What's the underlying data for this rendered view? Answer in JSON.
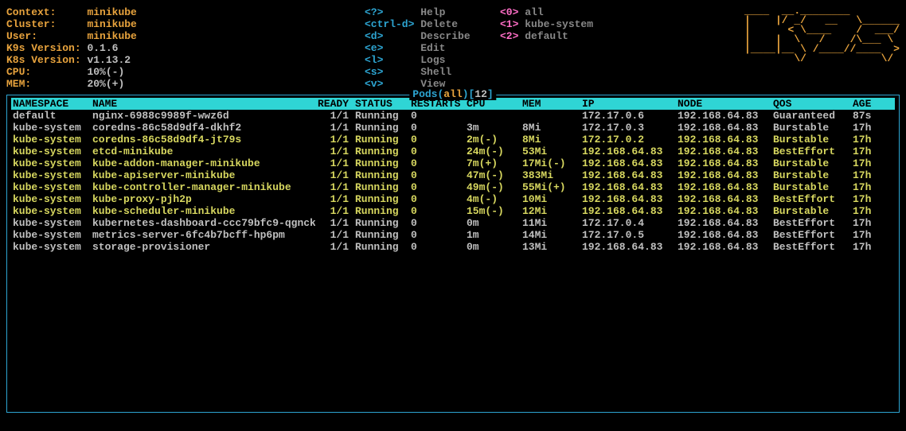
{
  "info": {
    "context_label": "Context:",
    "context": "minikube",
    "cluster_label": "Cluster:",
    "cluster": "minikube",
    "user_label": "User:",
    "user": "minikube",
    "k9s_label": "K9s Version:",
    "k9s": "0.1.6",
    "k8s_label": "K8s Version:",
    "k8s": "v1.13.2",
    "cpu_label": "CPU:",
    "cpu": "10%(-)",
    "mem_label": "MEM:",
    "mem": "20%(+)"
  },
  "hk1": {
    "help_k": "<?>",
    "help_d": "Help",
    "del_k": "<ctrl-d>",
    "del_d": "Delete",
    "desc_k": "<d>",
    "desc_d": "Describe",
    "edit_k": "<e>",
    "edit_d": "Edit",
    "logs_k": "<l>",
    "logs_d": "Logs",
    "shell_k": "<s>",
    "shell_d": "Shell",
    "view_k": "<v>",
    "view_d": "View"
  },
  "hk2": {
    "k0": "<0>",
    "d0": "all",
    "k1": "<1>",
    "d1": "kube-system",
    "k2": "<2>",
    "d2": "default"
  },
  "logo": "____  __.________       \n|    |/ _/   __   \\______\n|      < \\____    /  ___/\n|    |  \\   /    /\\___ \\ \n|____|__ \\ /____//____  >\n        \\/            \\/ ",
  "box": {
    "prefix": " Pods(",
    "all": "all",
    "mid": ")[",
    "count": "12",
    "suffix": "] "
  },
  "th": {
    "ns": "NAMESPACE",
    "name": "NAME",
    "ready": "READY",
    "status": "STATUS",
    "restarts": "RESTARTS",
    "cpu": "CPU",
    "mem": "MEM",
    "ip": "IP",
    "node": "NODE",
    "qos": "QOS",
    "age": "AGE"
  },
  "rows": [
    {
      "hl": false,
      "ns": "default",
      "name": "nginx-6988c9989f-wwz6d",
      "ready": "1/1",
      "status": "Running",
      "restarts": "0",
      "cpu": "",
      "mem": "",
      "ip": "172.17.0.6",
      "node": "192.168.64.83",
      "qos": "Guaranteed",
      "age": "87s"
    },
    {
      "hl": false,
      "ns": "kube-system",
      "name": "coredns-86c58d9df4-dkhf2",
      "ready": "1/1",
      "status": "Running",
      "restarts": "0",
      "cpu": "3m",
      "mem": "8Mi",
      "ip": "172.17.0.3",
      "node": "192.168.64.83",
      "qos": "Burstable",
      "age": "17h"
    },
    {
      "hl": true,
      "ns": "kube-system",
      "name": "coredns-86c58d9df4-jt79s",
      "ready": "1/1",
      "status": "Running",
      "restarts": "0",
      "cpu": "2m(-)",
      "mem": "8Mi",
      "ip": "172.17.0.2",
      "node": "192.168.64.83",
      "qos": "Burstable",
      "age": "17h"
    },
    {
      "hl": true,
      "ns": "kube-system",
      "name": "etcd-minikube",
      "ready": "1/1",
      "status": "Running",
      "restarts": "0",
      "cpu": "24m(-)",
      "mem": "53Mi",
      "ip": "192.168.64.83",
      "node": "192.168.64.83",
      "qos": "BestEffort",
      "age": "17h"
    },
    {
      "hl": true,
      "ns": "kube-system",
      "name": "kube-addon-manager-minikube",
      "ready": "1/1",
      "status": "Running",
      "restarts": "0",
      "cpu": "7m(+)",
      "mem": "17Mi(-)",
      "ip": "192.168.64.83",
      "node": "192.168.64.83",
      "qos": "Burstable",
      "age": "17h"
    },
    {
      "hl": true,
      "ns": "kube-system",
      "name": "kube-apiserver-minikube",
      "ready": "1/1",
      "status": "Running",
      "restarts": "0",
      "cpu": "47m(-)",
      "mem": "383Mi",
      "ip": "192.168.64.83",
      "node": "192.168.64.83",
      "qos": "Burstable",
      "age": "17h"
    },
    {
      "hl": true,
      "ns": "kube-system",
      "name": "kube-controller-manager-minikube",
      "ready": "1/1",
      "status": "Running",
      "restarts": "0",
      "cpu": "49m(-)",
      "mem": "55Mi(+)",
      "ip": "192.168.64.83",
      "node": "192.168.64.83",
      "qos": "Burstable",
      "age": "17h"
    },
    {
      "hl": true,
      "ns": "kube-system",
      "name": "kube-proxy-pjh2p",
      "ready": "1/1",
      "status": "Running",
      "restarts": "0",
      "cpu": "4m(-)",
      "mem": "10Mi",
      "ip": "192.168.64.83",
      "node": "192.168.64.83",
      "qos": "BestEffort",
      "age": "17h"
    },
    {
      "hl": true,
      "ns": "kube-system",
      "name": "kube-scheduler-minikube",
      "ready": "1/1",
      "status": "Running",
      "restarts": "0",
      "cpu": "15m(-)",
      "mem": "12Mi",
      "ip": "192.168.64.83",
      "node": "192.168.64.83",
      "qos": "Burstable",
      "age": "17h"
    },
    {
      "hl": false,
      "ns": "kube-system",
      "name": "kubernetes-dashboard-ccc79bfc9-qgnck",
      "ready": "1/1",
      "status": "Running",
      "restarts": "0",
      "cpu": "0m",
      "mem": "11Mi",
      "ip": "172.17.0.4",
      "node": "192.168.64.83",
      "qos": "BestEffort",
      "age": "17h"
    },
    {
      "hl": false,
      "ns": "kube-system",
      "name": "metrics-server-6fc4b7bcff-hp6pm",
      "ready": "1/1",
      "status": "Running",
      "restarts": "0",
      "cpu": "1m",
      "mem": "14Mi",
      "ip": "172.17.0.5",
      "node": "192.168.64.83",
      "qos": "BestEffort",
      "age": "17h"
    },
    {
      "hl": false,
      "ns": "kube-system",
      "name": "storage-provisioner",
      "ready": "1/1",
      "status": "Running",
      "restarts": "0",
      "cpu": "0m",
      "mem": "13Mi",
      "ip": "192.168.64.83",
      "node": "192.168.64.83",
      "qos": "BestEffort",
      "age": "17h"
    }
  ]
}
